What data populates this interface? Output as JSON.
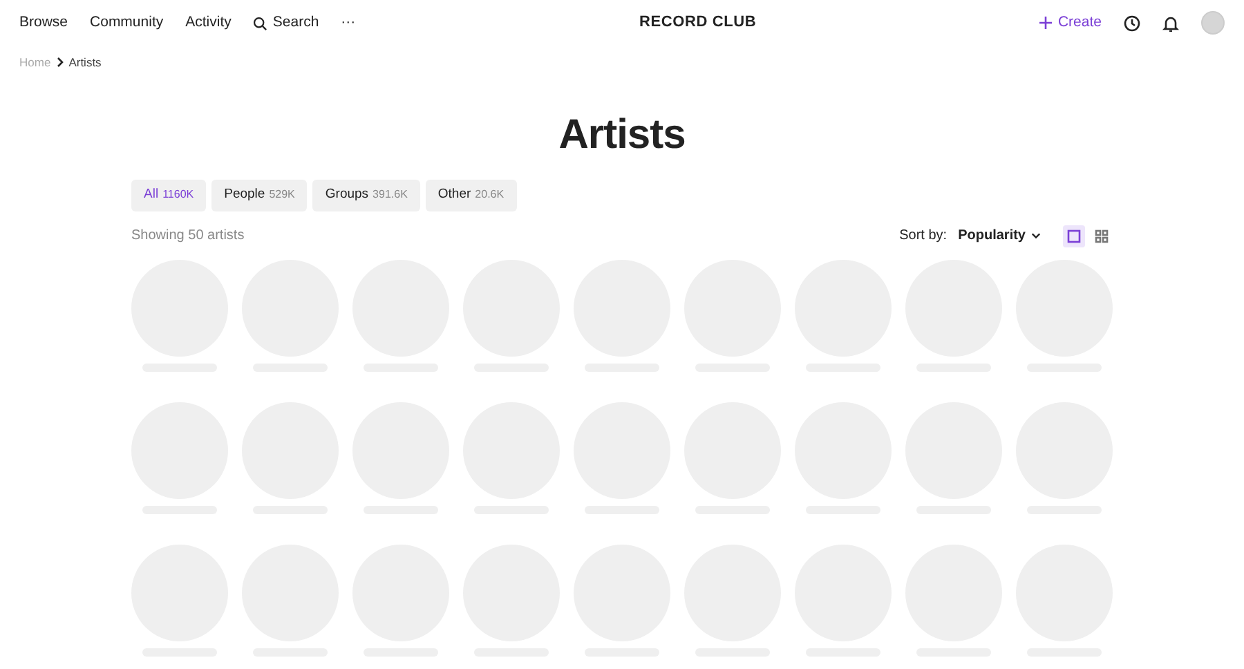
{
  "nav": {
    "links": [
      "Browse",
      "Community",
      "Activity"
    ],
    "search": "Search",
    "more": "···",
    "logo": "RECORD CLUB",
    "create": "Create"
  },
  "breadcrumb": [
    "Home",
    "Artists"
  ],
  "title": "Artists",
  "tabs": [
    {
      "label": "All",
      "count": "1160K",
      "selected": true
    },
    {
      "label": "People",
      "count": "529K",
      "selected": false
    },
    {
      "label": "Groups",
      "count": "391.6K",
      "selected": false
    },
    {
      "label": "Other",
      "count": "20.6K",
      "selected": false
    }
  ],
  "showing": "Showing 50 artists",
  "sort": {
    "label": "Sort by:",
    "value": "Popularity"
  },
  "views": [
    {
      "kind": "single",
      "selected": true
    },
    {
      "kind": "grid",
      "selected": false
    }
  ],
  "artists": [
    {
      "kind": "placeholder"
    },
    {
      "kind": "placeholder"
    },
    {
      "kind": "placeholder"
    },
    {
      "kind": "placeholder"
    },
    {
      "kind": "placeholder"
    },
    {
      "kind": "placeholder"
    },
    {
      "kind": "placeholder"
    },
    {
      "kind": "placeholder"
    },
    {
      "kind": "placeholder"
    },
    {
      "kind": "placeholder"
    },
    {
      "kind": "placeholder"
    },
    {
      "kind": "placeholder"
    },
    {
      "kind": "placeholder"
    },
    {
      "kind": "placeholder"
    },
    {
      "kind": "placeholder"
    },
    {
      "kind": "placeholder"
    },
    {
      "kind": "placeholder"
    },
    {
      "kind": "placeholder"
    },
    {
      "kind": "placeholder"
    },
    {
      "kind": "placeholder"
    },
    {
      "kind": "placeholder"
    },
    {
      "kind": "placeholder"
    },
    {
      "kind": "placeholder"
    },
    {
      "kind": "placeholder"
    },
    {
      "kind": "placeholder"
    },
    {
      "kind": "placeholder"
    },
    {
      "kind": "placeholder"
    }
  ]
}
